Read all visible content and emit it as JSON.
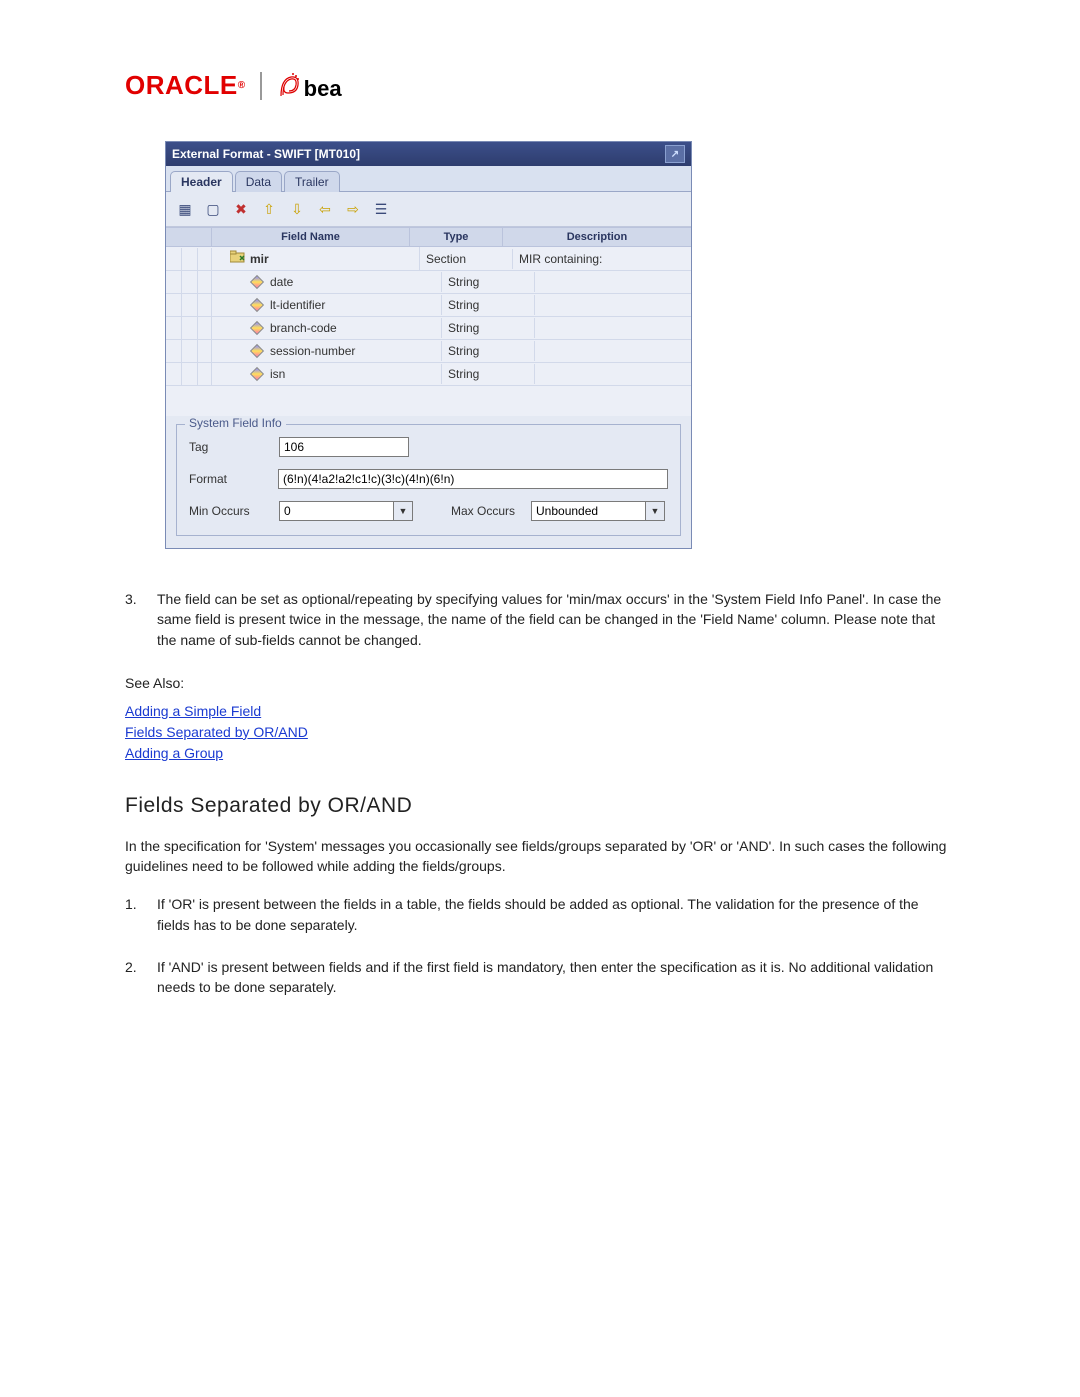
{
  "header": {
    "oracle_text": "ORACLE",
    "oracle_reg": "®",
    "bea_text": "bea"
  },
  "panel": {
    "title": "External Format - SWIFT [MT010]",
    "tabs": [
      {
        "label": "Header",
        "active": true
      },
      {
        "label": "Data",
        "active": false
      },
      {
        "label": "Trailer",
        "active": false
      }
    ],
    "toolbar_icons": [
      "grid-icon",
      "new-icon",
      "delete-icon",
      "up-arrow-icon",
      "down-arrow-icon",
      "left-arrow-icon",
      "right-arrow-icon",
      "properties-icon"
    ],
    "grid": {
      "columns": {
        "name": "Field Name",
        "type": "Type",
        "desc": "Description"
      },
      "rows": [
        {
          "level": 1,
          "icon": "folder",
          "name": "mir",
          "bold": true,
          "type": "Section",
          "desc": "MIR containing:"
        },
        {
          "level": 2,
          "icon": "diamond",
          "name": "date",
          "type": "String",
          "desc": ""
        },
        {
          "level": 2,
          "icon": "diamond",
          "name": "lt-identifier",
          "type": "String",
          "desc": ""
        },
        {
          "level": 2,
          "icon": "diamond",
          "name": "branch-code",
          "type": "String",
          "desc": ""
        },
        {
          "level": 2,
          "icon": "diamond",
          "name": "session-number",
          "type": "String",
          "desc": ""
        },
        {
          "level": 2,
          "icon": "diamond",
          "name": "isn",
          "type": "String",
          "desc": ""
        }
      ]
    },
    "fieldinfo": {
      "legend": "System Field Info",
      "tag_label": "Tag",
      "tag_value": "106",
      "format_label": "Format",
      "format_value": "(6!n)(4!a2!a2!c1!c)(3!c)(4!n)(6!n)",
      "min_label": "Min Occurs",
      "min_value": "0",
      "max_label": "Max Occurs",
      "max_value": "Unbounded"
    }
  },
  "step3_num": "3.",
  "step3_text": "The field can be set as optional/repeating by specifying values for 'min/max occurs' in the 'System Field Info Panel'. In case the same field is present twice in the message, the name of the field can be changed in the 'Field Name' column. Please note that the name of sub-fields cannot be changed.",
  "see_also_label": "See Also:",
  "links": {
    "l1": "Adding a Simple Field",
    "l2": "Fields Separated by OR/AND",
    "l3": "Adding a Group"
  },
  "section_h2": "Fields Separated by OR/AND",
  "section_para": "In the specification for 'System' messages you occasionally see fields/groups separated by 'OR' or 'AND'. In such cases the following guidelines need to be followed while adding the fields/groups.",
  "li1_num": "1.",
  "li1_text": "If 'OR' is present between the fields in a table, the fields should be added as optional. The validation for the presence of the fields has to be done separately.",
  "li2_num": "2.",
  "li2_text": "If 'AND' is present between fields and if the first field is mandatory, then enter the specification as it is. No additional validation needs to be done separately."
}
